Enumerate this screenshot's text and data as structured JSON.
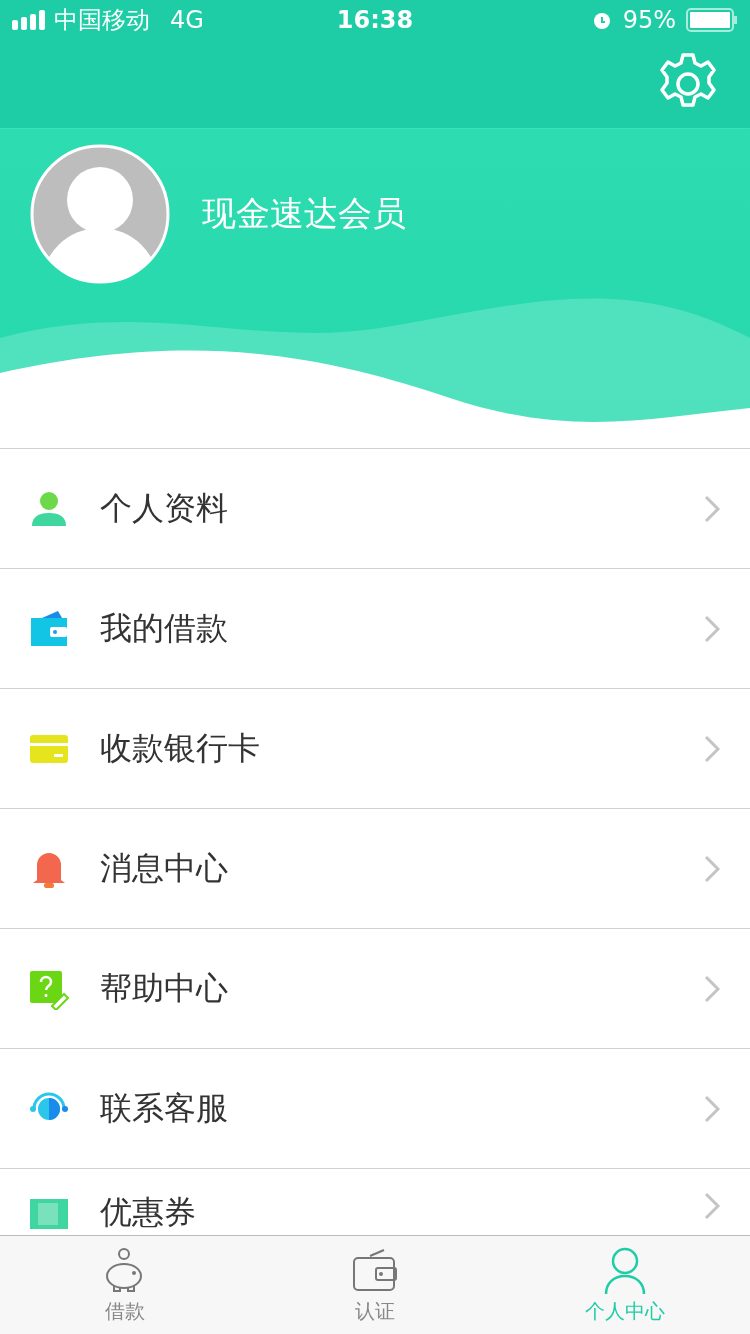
{
  "status_bar": {
    "carrier": "中国移动",
    "network": "4G",
    "time": "16:38",
    "battery": "95%"
  },
  "profile": {
    "name": "现金速达会员"
  },
  "menu": [
    {
      "kind": "person",
      "label": "个人资料"
    },
    {
      "kind": "wallet",
      "label": "我的借款"
    },
    {
      "kind": "card",
      "label": "收款银行卡"
    },
    {
      "kind": "bell",
      "label": "消息中心"
    },
    {
      "kind": "help",
      "label": "帮助中心"
    },
    {
      "kind": "service",
      "label": "联系客服"
    },
    {
      "kind": "coupon",
      "label": "优惠券"
    }
  ],
  "tab_bar": [
    {
      "kind": "piggy",
      "label": "借款",
      "selected": false
    },
    {
      "kind": "wallet",
      "label": "认证",
      "selected": false
    },
    {
      "kind": "person",
      "label": "个人中心",
      "selected": true
    }
  ]
}
